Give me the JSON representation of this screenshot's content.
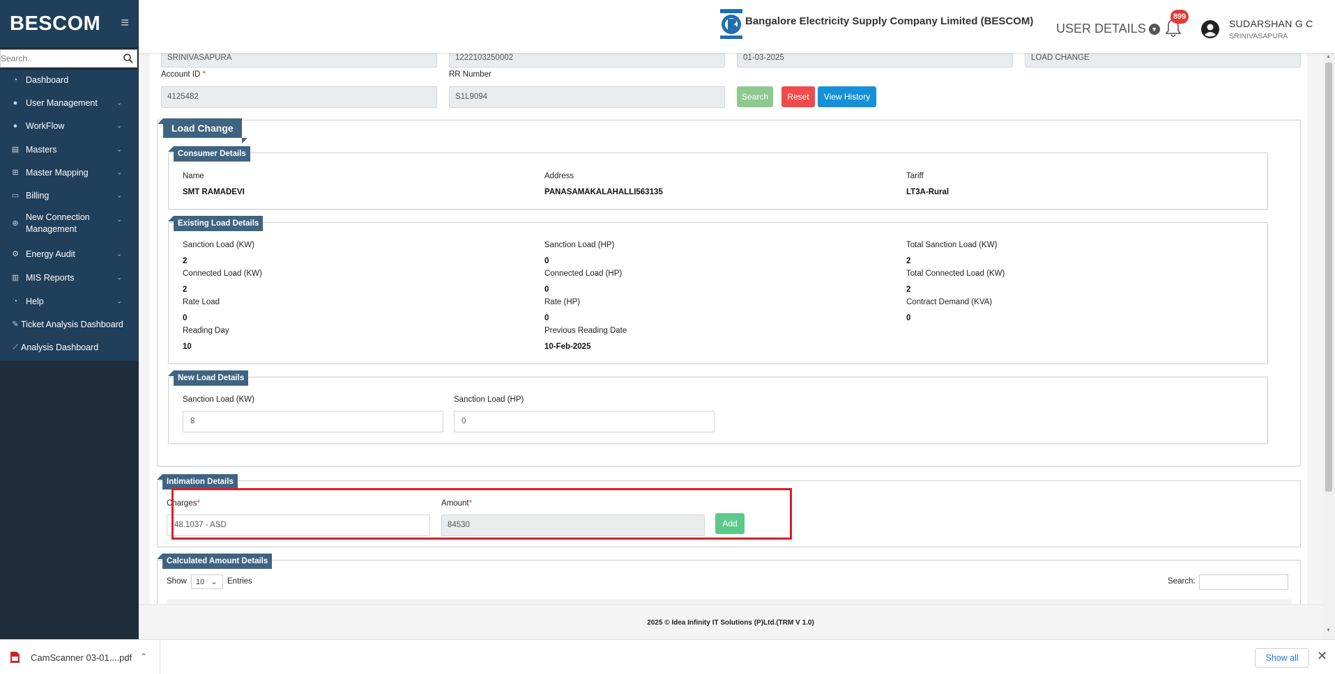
{
  "sidebar": {
    "brand": "BESCOM",
    "search_placeholder": "Search..",
    "items": [
      {
        "label": "Dashboard",
        "icon": "dashboard-icon",
        "has_children": false
      },
      {
        "label": "User Management",
        "icon": "user-icon",
        "has_children": true
      },
      {
        "label": "WorkFlow",
        "icon": "user-icon",
        "has_children": true
      },
      {
        "label": "Masters",
        "icon": "list-icon",
        "has_children": true
      },
      {
        "label": "Master Mapping",
        "icon": "sitemap-icon",
        "has_children": true
      },
      {
        "label": "Billing",
        "icon": "monitor-icon",
        "has_children": true
      },
      {
        "label": "New Connection",
        "label2": "Management",
        "icon": "plus-circle-icon",
        "has_children": true
      },
      {
        "label": "Energy Audit",
        "icon": "cogs-icon",
        "has_children": true
      },
      {
        "label": "MIS Reports",
        "icon": "bar-chart-icon",
        "has_children": true
      },
      {
        "label": "Help",
        "icon": "dashboard-icon",
        "has_children": true
      },
      {
        "label": "Ticket Analysis Dashboard",
        "icon": "ticket-icon",
        "has_children": false
      },
      {
        "label": "Analysis Dashboard",
        "icon": "line-chart-icon",
        "has_children": false
      }
    ]
  },
  "header": {
    "company": "Bangalore Electricity Supply Company Limited (BESCOM)",
    "user_details": "USER DETAILS",
    "notification_count": "899",
    "user_name": "SUDARSHAN G C",
    "user_location": "SRINIVASAPURA"
  },
  "top_fields": {
    "subdivision": "SRINIVASAPURA",
    "number": "1222103250002",
    "date": "01-03-2025",
    "request_type": "LOAD CHANGE",
    "account_id_label": "Account ID",
    "account_id": "4125482",
    "rr_label": "RR Number",
    "rr_number": "S1L9094",
    "search_btn": "Search",
    "reset_btn": "Reset",
    "history_btn": "View History"
  },
  "load_change": {
    "title": "Load Change",
    "consumer": {
      "title": "Consumer Details",
      "name_label": "Name",
      "name": "SMT RAMADEVI",
      "address_label": "Address",
      "address": "PANASAMAKALAHALLI563135",
      "tariff_label": "Tariff",
      "tariff": "LT3A-Rural"
    },
    "existing": {
      "title": "Existing Load Details",
      "rows": [
        [
          {
            "label": "Sanction Load (KW)",
            "value": "2"
          },
          {
            "label": "Sanction Load (HP)",
            "value": "0"
          },
          {
            "label": "Total Sanction Load (KW)",
            "value": "2"
          }
        ],
        [
          {
            "label": "Connected Load (KW)",
            "value": "2"
          },
          {
            "label": "Connected Load (HP)",
            "value": "0"
          },
          {
            "label": "Total Connected Load (KW)",
            "value": "2"
          }
        ],
        [
          {
            "label": "Rate Load",
            "value": "0"
          },
          {
            "label": "Rate (HP)",
            "value": "0"
          },
          {
            "label": "Contract Demand (KVA)",
            "value": "0"
          }
        ],
        [
          {
            "label": "Reading Day",
            "value": "10"
          },
          {
            "label": "Previous Reading Date",
            "value": "10-Feb-2025"
          }
        ]
      ]
    },
    "new_load": {
      "title": "New Load Details",
      "kw_label": "Sanction Load (KW)",
      "kw_value": "8",
      "hp_label": "Sanction Load (HP)",
      "hp_value": "0"
    }
  },
  "intimation": {
    "title": "Intimation Details",
    "charges_label": "Charges",
    "charges_value": "48.1037 - ASD",
    "amount_label": "Amount",
    "amount_value": "84530",
    "add_btn": "Add"
  },
  "calculated": {
    "title": "Calculated Amount Details",
    "show_label": "Show",
    "entries_value": "10",
    "entries_label": "Entries",
    "search_label": "Search:"
  },
  "footer": "2025 © Idea Infinity IT Solutions (P)Ltd.(TRM V 1.0)",
  "download_bar": {
    "file_name": "CamScanner 03-01....pdf",
    "show_all": "Show all"
  },
  "colors": {
    "sidebar_bg": "#1f3f5b",
    "tag_bg": "#3f6482",
    "search_btn": "#8cc98f",
    "reset_btn": "#ef4b4b",
    "history_btn": "#1591d8",
    "add_btn": "#5cc98a",
    "highlight": "#e01b24"
  }
}
